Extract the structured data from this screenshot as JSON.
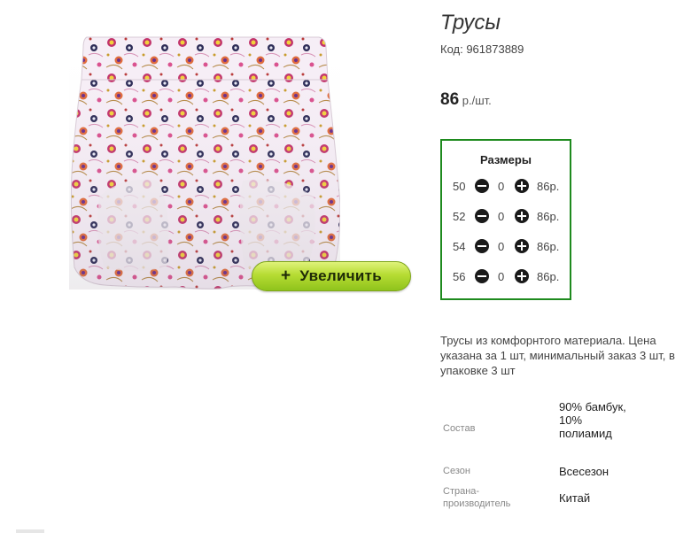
{
  "product": {
    "title": "Трусы",
    "code": "Код: 961873889",
    "price_amount": "86",
    "price_unit": "р./шт.",
    "zoom_plus": "+",
    "zoom_label": "Увеличить"
  },
  "sizes": {
    "title": "Размеры",
    "rows": [
      {
        "size": "50",
        "qty": "0",
        "price": "86р."
      },
      {
        "size": "52",
        "qty": "0",
        "price": "86р."
      },
      {
        "size": "54",
        "qty": "0",
        "price": "86р."
      },
      {
        "size": "56",
        "qty": "0",
        "price": "86р."
      }
    ]
  },
  "description": "Трусы из комфорнтого материала. Цена указана за 1 шт, минимальный заказ 3 шт, в упаковке 3 шт",
  "specs": [
    {
      "label": "Состав",
      "value": "90% бамбук, 10% полиамид"
    },
    {
      "label": "Сезон",
      "value": "Всесезон"
    },
    {
      "label": "Страна-производитель",
      "value": "Китай"
    }
  ],
  "colors": {
    "accent_border": "#1e8a1e",
    "zoom_button": "#b6dc33"
  }
}
